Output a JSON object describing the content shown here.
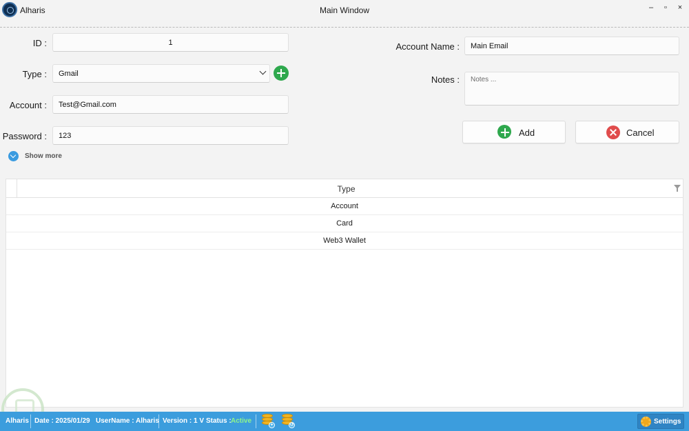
{
  "window": {
    "app_name": "Alharis",
    "title": "Main Window"
  },
  "window_controls": {
    "minimize": "–",
    "maximize": "▫",
    "close": "×"
  },
  "form": {
    "id_label": "ID :",
    "id_value": "1",
    "type_label": "Type :",
    "type_value": "Gmail",
    "account_label": "Account :",
    "account_value": "Test@Gmail.com",
    "password_label": "Password :",
    "password_value": "123",
    "show_more": "Show more",
    "account_name_label": "Account Name :",
    "account_name_value": "Main Email",
    "notes_label": "Notes :",
    "notes_placeholder": "Notes ...",
    "add_label": "Add",
    "cancel_label": "Cancel"
  },
  "grid": {
    "header": "Type",
    "rows": [
      "Account",
      "Card",
      "Web3 Wallet"
    ]
  },
  "statusbar": {
    "app": "Alharis",
    "date": "Date : 2025/01/29",
    "username": "UserName : Alharis",
    "version": "Version : 1 V",
    "status_label": "Status :",
    "status_value": "Active",
    "settings_label": "Settings"
  },
  "colors": {
    "accent": "#3c9ddd",
    "add_green": "#2ea84d",
    "cancel_red": "#e04c4c",
    "status_active": "#8ff58a"
  }
}
